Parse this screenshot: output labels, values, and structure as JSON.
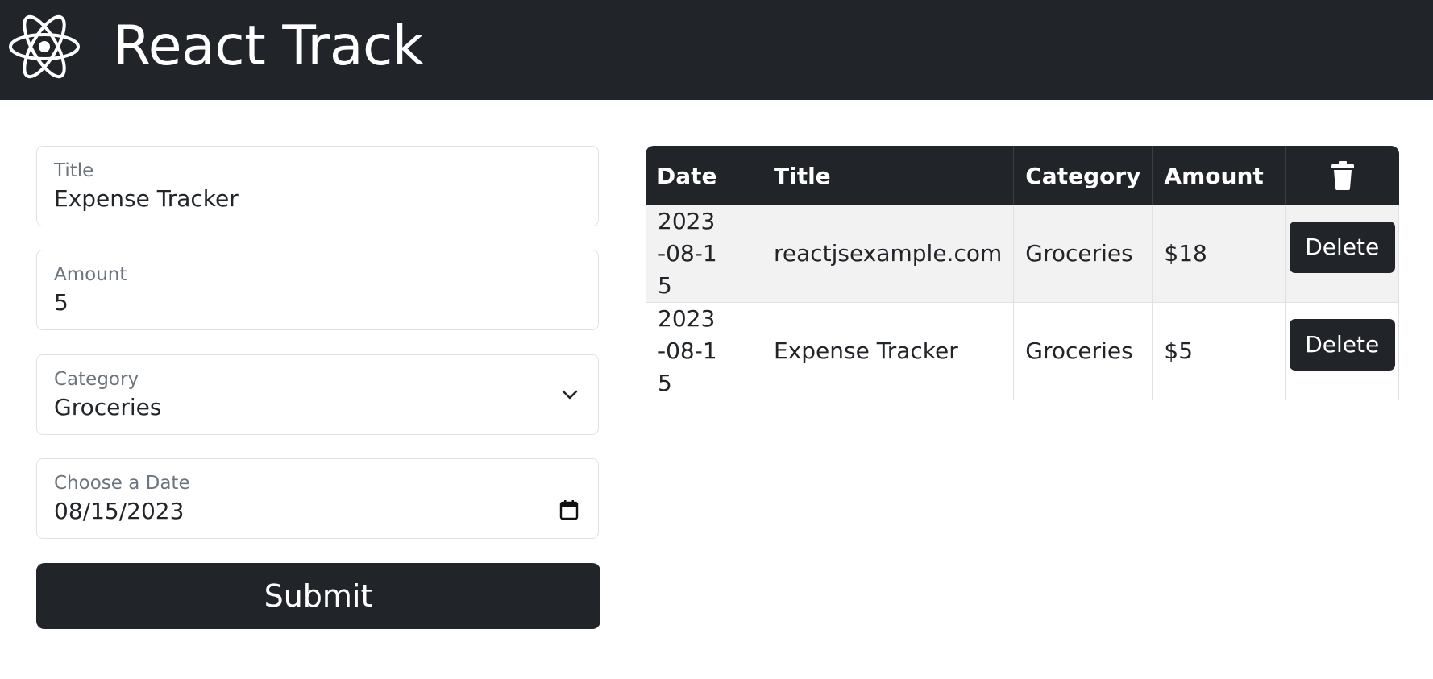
{
  "app": {
    "title": "React Track",
    "logo_icon": "react-atom-icon"
  },
  "form": {
    "title_label": "Title",
    "title_value": "Expense Tracker",
    "amount_label": "Amount",
    "amount_value": "5",
    "category_label": "Category",
    "category_value": "Groceries",
    "date_label": "Choose a Date",
    "date_value": "08/15/2023",
    "submit_label": "Submit"
  },
  "table": {
    "headers": {
      "date": "Date",
      "title": "Title",
      "category": "Category",
      "amount": "Amount",
      "delete_icon": "trash-icon"
    },
    "rows": [
      {
        "date": "2023-08-15",
        "title": "reactjsexample.com",
        "category": "Groceries",
        "amount": "$18",
        "action": "Delete"
      },
      {
        "date": "2023-08-15",
        "title": "Expense Tracker",
        "category": "Groceries",
        "amount": "$5",
        "action": "Delete"
      }
    ]
  },
  "colors": {
    "dark": "#212529",
    "border": "#dee2e6",
    "stripe": "#f2f2f2",
    "muted": "#6c757d"
  }
}
